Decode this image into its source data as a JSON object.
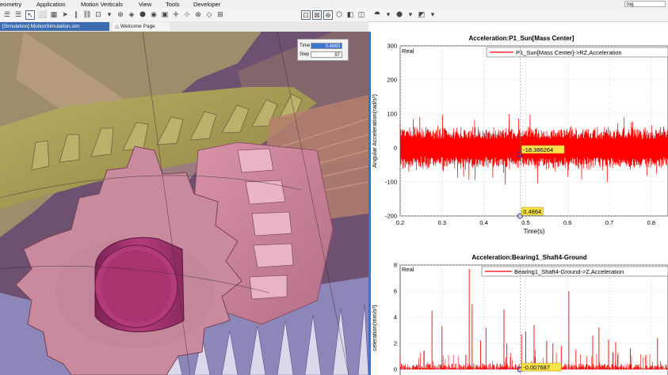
{
  "menu": {
    "items": [
      "eometry",
      "Application",
      "Motion Verticals",
      "View",
      "Tools",
      "Developer"
    ],
    "search_value": "log"
  },
  "tabs": [
    {
      "label": "[Simulation] MotionSimulation.sim",
      "active": true
    },
    {
      "label": "Welcome Page",
      "active": false
    }
  ],
  "time_panel": {
    "time_label": "Time",
    "time_value": "0.4860",
    "step_label": "Step",
    "step_value": "97"
  },
  "colors": {
    "accent": "#2d78d0",
    "series": "#ff0000",
    "tab_active": "#3d6db0"
  },
  "chart_data": [
    {
      "type": "line",
      "title": "Acceleration:P1_Sun[Mass Center]",
      "corner_label": "Real",
      "legend": "P1_Sun[Mass Center]->RZ,Acceleration",
      "xlabel": "Time(s)",
      "ylabel": "Angular Acceleration(rad/s²)",
      "xlim": [
        0.2,
        0.84
      ],
      "ylim": [
        -200,
        300
      ],
      "xticks": [
        0.2,
        0.3,
        0.4,
        0.5,
        0.6,
        0.7,
        0.8
      ],
      "yticks": [
        -200,
        -100,
        0,
        100,
        200,
        300
      ],
      "band": {
        "center": 0,
        "half_width": 50,
        "peak": 115
      },
      "cursor": {
        "x": 0.4864,
        "y": -18.386264,
        "x_label": "0.4864",
        "y_label": "-18.386264"
      },
      "grid": true,
      "legend_position": "top-right"
    },
    {
      "type": "line",
      "title": "Acceleration:Bearing1_Shaft4-Ground",
      "corner_label": "Real",
      "legend": "Bearing1_Shaft4-Ground->Z,Acceleration",
      "ylabel": "celeration(mm/s²)",
      "xlim": [
        0.2,
        0.84
      ],
      "ylim": [
        0,
        8
      ],
      "yticks": [
        0,
        2,
        4,
        6,
        8
      ],
      "spikes": [
        {
          "x": 0.276,
          "y": 4.5
        },
        {
          "x": 0.3,
          "y": 3.3
        },
        {
          "x": 0.365,
          "y": 7.7
        },
        {
          "x": 0.372,
          "y": 5.0
        },
        {
          "x": 0.392,
          "y": 2.2
        },
        {
          "x": 0.405,
          "y": 3.2
        },
        {
          "x": 0.448,
          "y": 4.6
        },
        {
          "x": 0.455,
          "y": 2.0
        },
        {
          "x": 0.49,
          "y": 2.7
        },
        {
          "x": 0.5,
          "y": 2.9
        },
        {
          "x": 0.52,
          "y": 3.4
        },
        {
          "x": 0.55,
          "y": 2.2
        },
        {
          "x": 0.565,
          "y": 2.0
        },
        {
          "x": 0.585,
          "y": 1.8
        },
        {
          "x": 0.603,
          "y": 6.0
        },
        {
          "x": 0.62,
          "y": 1.5
        },
        {
          "x": 0.66,
          "y": 2.6
        },
        {
          "x": 0.675,
          "y": 3.2
        },
        {
          "x": 0.698,
          "y": 2.3
        },
        {
          "x": 0.715,
          "y": 2.1
        },
        {
          "x": 0.75,
          "y": 1.6
        },
        {
          "x": 0.815,
          "y": 2.4
        }
      ],
      "cursor": {
        "x": 0.4864,
        "y": -0.007687,
        "y_label": "-0.007687"
      },
      "grid": true,
      "legend_position": "top-right"
    }
  ]
}
